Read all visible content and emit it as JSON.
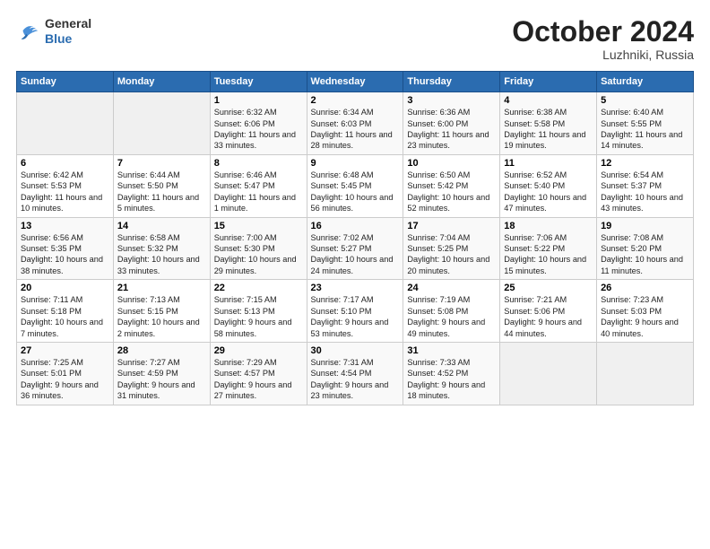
{
  "logo": {
    "general": "General",
    "blue": "Blue"
  },
  "title": "October 2024",
  "location": "Luzhniki, Russia",
  "days_header": [
    "Sunday",
    "Monday",
    "Tuesday",
    "Wednesday",
    "Thursday",
    "Friday",
    "Saturday"
  ],
  "weeks": [
    [
      {
        "day": "",
        "info": ""
      },
      {
        "day": "",
        "info": ""
      },
      {
        "day": "1",
        "info": "Sunrise: 6:32 AM\nSunset: 6:06 PM\nDaylight: 11 hours\nand 33 minutes."
      },
      {
        "day": "2",
        "info": "Sunrise: 6:34 AM\nSunset: 6:03 PM\nDaylight: 11 hours\nand 28 minutes."
      },
      {
        "day": "3",
        "info": "Sunrise: 6:36 AM\nSunset: 6:00 PM\nDaylight: 11 hours\nand 23 minutes."
      },
      {
        "day": "4",
        "info": "Sunrise: 6:38 AM\nSunset: 5:58 PM\nDaylight: 11 hours\nand 19 minutes."
      },
      {
        "day": "5",
        "info": "Sunrise: 6:40 AM\nSunset: 5:55 PM\nDaylight: 11 hours\nand 14 minutes."
      }
    ],
    [
      {
        "day": "6",
        "info": "Sunrise: 6:42 AM\nSunset: 5:53 PM\nDaylight: 11 hours\nand 10 minutes."
      },
      {
        "day": "7",
        "info": "Sunrise: 6:44 AM\nSunset: 5:50 PM\nDaylight: 11 hours\nand 5 minutes."
      },
      {
        "day": "8",
        "info": "Sunrise: 6:46 AM\nSunset: 5:47 PM\nDaylight: 11 hours\nand 1 minute."
      },
      {
        "day": "9",
        "info": "Sunrise: 6:48 AM\nSunset: 5:45 PM\nDaylight: 10 hours\nand 56 minutes."
      },
      {
        "day": "10",
        "info": "Sunrise: 6:50 AM\nSunset: 5:42 PM\nDaylight: 10 hours\nand 52 minutes."
      },
      {
        "day": "11",
        "info": "Sunrise: 6:52 AM\nSunset: 5:40 PM\nDaylight: 10 hours\nand 47 minutes."
      },
      {
        "day": "12",
        "info": "Sunrise: 6:54 AM\nSunset: 5:37 PM\nDaylight: 10 hours\nand 43 minutes."
      }
    ],
    [
      {
        "day": "13",
        "info": "Sunrise: 6:56 AM\nSunset: 5:35 PM\nDaylight: 10 hours\nand 38 minutes."
      },
      {
        "day": "14",
        "info": "Sunrise: 6:58 AM\nSunset: 5:32 PM\nDaylight: 10 hours\nand 33 minutes."
      },
      {
        "day": "15",
        "info": "Sunrise: 7:00 AM\nSunset: 5:30 PM\nDaylight: 10 hours\nand 29 minutes."
      },
      {
        "day": "16",
        "info": "Sunrise: 7:02 AM\nSunset: 5:27 PM\nDaylight: 10 hours\nand 24 minutes."
      },
      {
        "day": "17",
        "info": "Sunrise: 7:04 AM\nSunset: 5:25 PM\nDaylight: 10 hours\nand 20 minutes."
      },
      {
        "day": "18",
        "info": "Sunrise: 7:06 AM\nSunset: 5:22 PM\nDaylight: 10 hours\nand 15 minutes."
      },
      {
        "day": "19",
        "info": "Sunrise: 7:08 AM\nSunset: 5:20 PM\nDaylight: 10 hours\nand 11 minutes."
      }
    ],
    [
      {
        "day": "20",
        "info": "Sunrise: 7:11 AM\nSunset: 5:18 PM\nDaylight: 10 hours\nand 7 minutes."
      },
      {
        "day": "21",
        "info": "Sunrise: 7:13 AM\nSunset: 5:15 PM\nDaylight: 10 hours\nand 2 minutes."
      },
      {
        "day": "22",
        "info": "Sunrise: 7:15 AM\nSunset: 5:13 PM\nDaylight: 9 hours\nand 58 minutes."
      },
      {
        "day": "23",
        "info": "Sunrise: 7:17 AM\nSunset: 5:10 PM\nDaylight: 9 hours\nand 53 minutes."
      },
      {
        "day": "24",
        "info": "Sunrise: 7:19 AM\nSunset: 5:08 PM\nDaylight: 9 hours\nand 49 minutes."
      },
      {
        "day": "25",
        "info": "Sunrise: 7:21 AM\nSunset: 5:06 PM\nDaylight: 9 hours\nand 44 minutes."
      },
      {
        "day": "26",
        "info": "Sunrise: 7:23 AM\nSunset: 5:03 PM\nDaylight: 9 hours\nand 40 minutes."
      }
    ],
    [
      {
        "day": "27",
        "info": "Sunrise: 7:25 AM\nSunset: 5:01 PM\nDaylight: 9 hours\nand 36 minutes."
      },
      {
        "day": "28",
        "info": "Sunrise: 7:27 AM\nSunset: 4:59 PM\nDaylight: 9 hours\nand 31 minutes."
      },
      {
        "day": "29",
        "info": "Sunrise: 7:29 AM\nSunset: 4:57 PM\nDaylight: 9 hours\nand 27 minutes."
      },
      {
        "day": "30",
        "info": "Sunrise: 7:31 AM\nSunset: 4:54 PM\nDaylight: 9 hours\nand 23 minutes."
      },
      {
        "day": "31",
        "info": "Sunrise: 7:33 AM\nSunset: 4:52 PM\nDaylight: 9 hours\nand 18 minutes."
      },
      {
        "day": "",
        "info": ""
      },
      {
        "day": "",
        "info": ""
      }
    ]
  ]
}
